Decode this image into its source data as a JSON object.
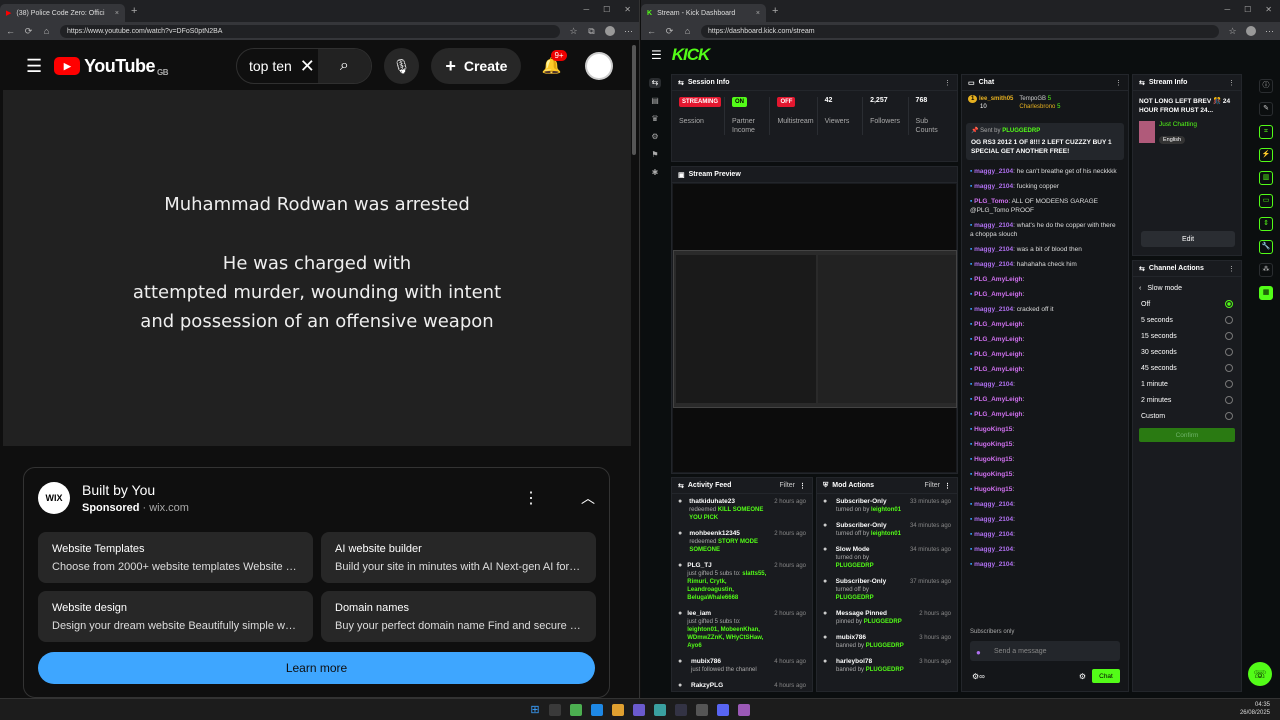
{
  "left_browser": {
    "tab_title": "(38) Police Code Zero: Offici",
    "url": "https://www.youtube.com/watch?v=DFoS0ptN2BA",
    "new_tab": "+",
    "close": "×"
  },
  "youtube": {
    "logo_text": "YouTube",
    "region": "GB",
    "search_value": "top ten",
    "create_label": "Create",
    "notif_count": "9+",
    "video_lines": [
      "Muhammad Rodwan was arrested",
      "He was charged with",
      "attempted murder, wounding with intent",
      "and possession of an offensive weapon"
    ],
    "ad": {
      "logo": "WIX",
      "title": "Built by You",
      "sponsored": "Sponsored",
      "domain": "wix.com",
      "tiles": [
        {
          "title": "Website Templates",
          "desc": "Choose from 2000+ website templates Website te..."
        },
        {
          "title": "AI website builder",
          "desc": "Build your site in minutes with AI Next-gen AI for sp..."
        },
        {
          "title": "Website design",
          "desc": "Design your dream website Beautifully simple webs..."
        },
        {
          "title": "Domain names",
          "desc": "Buy your perfect domain name Find and secure the ..."
        }
      ],
      "cta": "Learn more"
    }
  },
  "right_browser": {
    "tab_title": "Stream - Kick Dashboard",
    "url": "https://dashboard.kick.com/stream",
    "new_tab": "+",
    "close": "×"
  },
  "kick": {
    "logo": "KICK",
    "session": {
      "title": "Session Info",
      "items": [
        {
          "value": "STREAMING",
          "label": "Session",
          "color": "#e3172f"
        },
        {
          "value": "ON",
          "label": "Partner Income",
          "color": "#53fc18"
        },
        {
          "value": "OFF",
          "label": "Multistream",
          "color": "#e3172f"
        },
        {
          "value": "42",
          "label": "Viewers"
        },
        {
          "value": "2,257",
          "label": "Followers"
        },
        {
          "value": "768",
          "label": "Sub Counts"
        }
      ]
    },
    "preview": {
      "title": "Stream Preview"
    },
    "activity": {
      "title": "Activity Feed",
      "filter": "Filter",
      "items": [
        {
          "name": "thatkiduhate23",
          "desc_pre": "redeemed",
          "desc_hl": "KILL SOMEONE YOU PICK",
          "time": "2 hours ago"
        },
        {
          "name": "mohbeenk12345",
          "desc_pre": "redeemed",
          "desc_hl": "STORY MODE SOMEONE",
          "time": "2 hours ago"
        },
        {
          "name": "PLG_TJ",
          "desc_pre": "just gifted 5 subs to:",
          "desc_hl": "slatts55, Rimuri, Crytk, Leandroagustin, BelugaWhale6668",
          "time": "2 hours ago"
        },
        {
          "name": "lee_iam",
          "desc_pre": "just gifted 5 subs to:",
          "desc_hl": "leighton01, MobeenKhan, WDmwZZnK, WHyCtSHaw, Ayo6",
          "time": "2 hours ago"
        },
        {
          "name": "mubix786",
          "desc_pre": "just followed the channel",
          "desc_hl": "",
          "time": "4 hours ago"
        },
        {
          "name": "RakzyPLG",
          "desc_pre": "just followed the channel",
          "desc_hl": "",
          "time": "4 hours ago"
        }
      ]
    },
    "mod": {
      "title": "Mod Actions",
      "filter": "Filter",
      "items": [
        {
          "name": "Subscriber-Only",
          "desc_pre": "turned on by",
          "desc_hl": "leighton01",
          "time": "33 minutes ago"
        },
        {
          "name": "Subscriber-Only",
          "desc_pre": "turned off by",
          "desc_hl": "leighton01",
          "time": "34 minutes ago"
        },
        {
          "name": "Slow Mode",
          "desc_pre": "turned on by",
          "desc_hl": "PLUGGEDRP",
          "time": "34 minutes ago"
        },
        {
          "name": "Subscriber-Only",
          "desc_pre": "turned off by",
          "desc_hl": "PLUGGEDRP",
          "time": "37 minutes ago"
        },
        {
          "name": "Message Pinned",
          "desc_pre": "pinned by",
          "desc_hl": "PLUGGEDRP",
          "time": "2 hours ago"
        },
        {
          "name": "mubix786",
          "desc_pre": "banned by",
          "desc_hl": "PLUGGEDRP",
          "time": "3 hours ago"
        },
        {
          "name": "harleybol78",
          "desc_pre": "banned by",
          "desc_hl": "PLUGGEDRP",
          "time": "3 hours ago"
        }
      ]
    },
    "chat": {
      "title": "Chat",
      "leaders": [
        {
          "rank": "1",
          "name": "lee_smith05",
          "count": "10"
        },
        {
          "name": "TempoGB",
          "count": "5"
        },
        {
          "name": "Charlesbrono",
          "count": "5"
        }
      ],
      "pinned_by": "Sent by",
      "pinned_user": "PLUGGEDRP",
      "pinned_text": "OG RS3 2012 1 OF 8!!! 2 LEFT CUZZZY BUY 1 SPECIAL GET ANOTHER FREE!",
      "messages": [
        {
          "user": "maggy_2104",
          "text": ": he can't breathe get of his neckkkk"
        },
        {
          "user": "maggy_2104",
          "text": ": fucking copper"
        },
        {
          "user": "PLG_Tomo",
          "text": ": ALL OF MODEENS GARAGE @PLG_Tomo PROOF"
        },
        {
          "user": "maggy_2104",
          "text": ": what's he do the copper with there a choppa slouch"
        },
        {
          "user": "maggy_2104",
          "text": ": was a bit of blood then"
        },
        {
          "user": "maggy_2104",
          "text": ": hahahaha check him"
        },
        {
          "user": "PLG_AmyLeigh",
          "text": ":"
        },
        {
          "user": "PLG_AmyLeigh",
          "text": ":"
        },
        {
          "user": "maggy_2104",
          "text": ": cracked off it"
        },
        {
          "user": "PLG_AmyLeigh",
          "text": ":"
        },
        {
          "user": "PLG_AmyLeigh",
          "text": ":"
        },
        {
          "user": "PLG_AmyLeigh",
          "text": ":"
        },
        {
          "user": "PLG_AmyLeigh",
          "text": ":"
        },
        {
          "user": "maggy_2104",
          "text": ":"
        },
        {
          "user": "PLG_AmyLeigh",
          "text": ":"
        },
        {
          "user": "PLG_AmyLeigh",
          "text": ":"
        },
        {
          "user": "HugoKing15",
          "text": ":"
        },
        {
          "user": "HugoKing15",
          "text": ":"
        },
        {
          "user": "HugoKing15",
          "text": ":"
        },
        {
          "user": "HugoKing15",
          "text": ":"
        },
        {
          "user": "HugoKing15",
          "text": ":"
        },
        {
          "user": "maggy_2104",
          "text": ":"
        },
        {
          "user": "maggy_2104",
          "text": ":"
        },
        {
          "user": "maggy_2104",
          "text": ":"
        },
        {
          "user": "maggy_2104",
          "text": ":"
        },
        {
          "user": "maggy_2104",
          "text": ":"
        }
      ],
      "subs_only": "Subscribers only",
      "placeholder": "Send a message",
      "send": "Chat"
    },
    "stream_info": {
      "title": "Stream Info",
      "stream_title": "NOT LONG LEFT BREV 🎊 24 HOUR FROM RUST 24...",
      "category": "Just Chatting",
      "language": "English",
      "edit": "Edit"
    },
    "channel_actions": {
      "title": "Channel Actions",
      "section": "Slow mode",
      "options": [
        "Off",
        "5 seconds",
        "15 seconds",
        "30 seconds",
        "45 seconds",
        "1 minute",
        "2 minutes",
        "Custom"
      ],
      "selected": "Off",
      "confirm": "Confirm"
    }
  },
  "taskbar": {
    "time": "04:35",
    "date": "26/08/2025"
  }
}
